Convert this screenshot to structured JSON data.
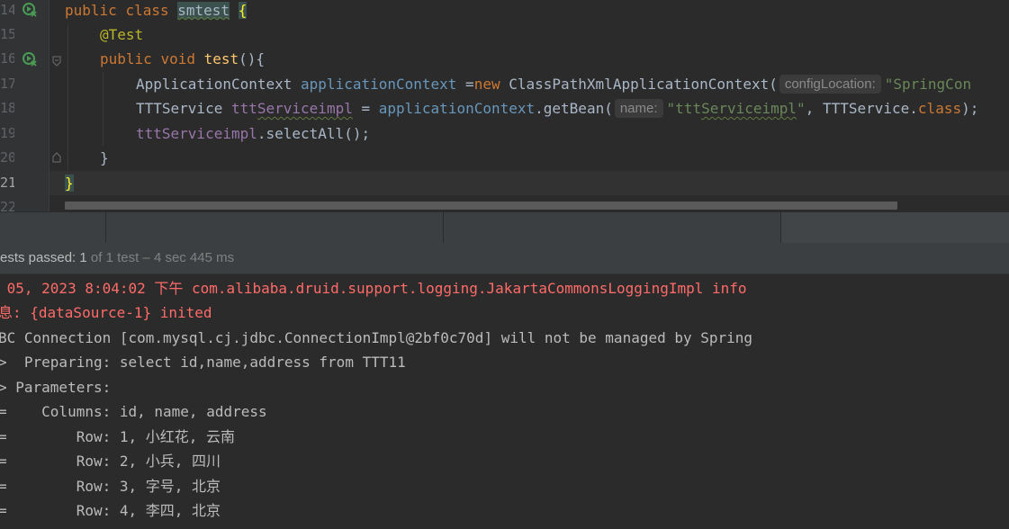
{
  "editor": {
    "line_numbers": [
      "14",
      "15",
      "16",
      "17",
      "18",
      "19",
      "20",
      "21",
      "22"
    ],
    "line14": {
      "kw1": "public",
      "kw2": "class",
      "classname": "smtest",
      "brace": "{"
    },
    "line15": {
      "annotation": "@Test"
    },
    "line16": {
      "kw1": "public",
      "kw2": "void",
      "method": "test",
      "parens": "(){"
    },
    "line17": {
      "type": "ApplicationContext",
      "var": "applicationContext",
      "assign": " =",
      "kw_new": "new",
      "ctor": " ClassPathXmlApplicationContext(",
      "hint": "configLocation:",
      "str": "\"SpringCon"
    },
    "line18": {
      "type": "TTTService ",
      "var_a": "ttt",
      "var_b": "Serviceimpl",
      "assign": " = ",
      "obj": "applicationContext",
      "call": ".getBean(",
      "hint": "name:",
      "str_a": "\"ttt",
      "str_b": "Serviceimpl",
      "str_c": "\"",
      "rest": ", TTTService.",
      "kw_class": "class",
      "end": ");"
    },
    "line19": {
      "var": "tttServiceimpl",
      "call": ".selectAll();"
    },
    "line20": {
      "brace": "}"
    },
    "line21": {
      "brace": "}"
    }
  },
  "test_status": {
    "passed_label": "ests passed: ",
    "passed_count": "1",
    "detail": " of 1 test – 4 sec 445 ms"
  },
  "console": {
    "lines": [
      " 05, 2023 8:04:02 下午 com.alibaba.druid.support.logging.JakartaCommonsLoggingImpl info",
      "息: {dataSource-1} inited",
      "BC Connection [com.mysql.cj.jdbc.ConnectionImpl@2bf0c70d] will not be managed by Spring",
      ">  Preparing: select id,name,address from TTT11",
      "> Parameters: ",
      "=    Columns: id, name, address",
      "=        Row: 1, 小红花, 云南",
      "=        Row: 2, 小兵, 四川",
      "=        Row: 3, 字号, 北京",
      "=        Row: 4, 李四, 北京"
    ]
  },
  "colors": {
    "keyword": "#cc7832",
    "string": "#6a8759",
    "field": "#9876aa",
    "error": "#ff6b68"
  }
}
